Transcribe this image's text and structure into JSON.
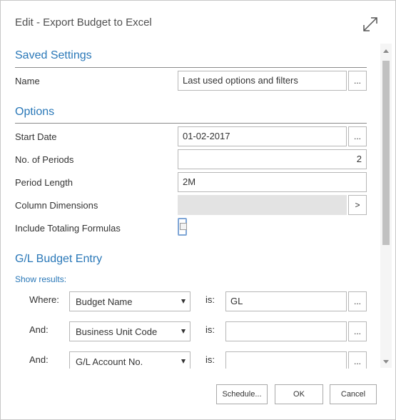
{
  "dialog": {
    "title": "Edit - Export Budget to Excel"
  },
  "saved_settings": {
    "section_title": "Saved Settings",
    "name_label": "Name",
    "name_value": "Last used options and filters",
    "lookup_label": "..."
  },
  "options": {
    "section_title": "Options",
    "start_date_label": "Start Date",
    "start_date_value": "01-02-2017",
    "start_date_lookup": "...",
    "periods_label": "No. of Periods",
    "periods_value": "2",
    "period_length_label": "Period Length",
    "period_length_value": "2M",
    "column_dimensions_label": "Column Dimensions",
    "column_dimensions_value": "",
    "column_dimensions_button": ">",
    "include_totaling_label": "Include Totaling Formulas",
    "include_totaling_checked": false
  },
  "budget_entry": {
    "section_title": "G/L Budget Entry",
    "show_results_label": "Show results:",
    "is_label": "is:",
    "filters": [
      {
        "connector": "Where:",
        "field": "Budget Name",
        "value": "GL",
        "lookup": "..."
      },
      {
        "connector": "And:",
        "field": "Business Unit Code",
        "value": "",
        "lookup": "..."
      },
      {
        "connector": "And:",
        "field": "G/L Account No.",
        "value": "",
        "lookup": "..."
      }
    ]
  },
  "footer": {
    "schedule_label": "Schedule...",
    "ok_label": "OK",
    "cancel_label": "Cancel"
  },
  "colors": {
    "accent": "#2a78b8",
    "border": "#b7b7b7",
    "disabled_field": "#e3e3e3"
  }
}
